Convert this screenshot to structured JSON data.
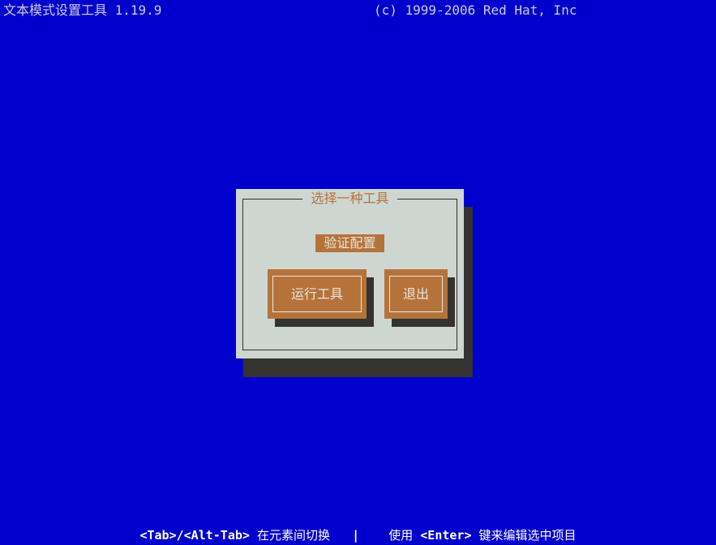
{
  "header": {
    "title": "文本模式设置工具 1.19.9",
    "copyright": "(c) 1999-2006 Red Hat, Inc"
  },
  "dialog": {
    "title": "选择一种工具",
    "list": [
      {
        "label": "验证配置",
        "selected": true
      }
    ],
    "buttons": [
      {
        "label": "运行工具",
        "focused": true
      },
      {
        "label": "退出",
        "focused": false
      }
    ]
  },
  "footer": {
    "keys_switch": "<Tab>/<Alt-Tab>",
    "text_switch": " 在元素间切换",
    "separator": "   |   ",
    "text_use_prefix": " 使用 ",
    "keys_enter": "<Enter>",
    "text_use_suffix": " 键来编辑选中项目"
  },
  "colors": {
    "screen_background": "#0000cc",
    "dialog_background": "#ced6d2",
    "dialog_border": "#2e2e2e",
    "accent_orange": "#b5733a",
    "shadow": "#353330",
    "text_light": "#e9e5de",
    "header_text": "#ccccdd",
    "footer_text": "#ffffff"
  }
}
